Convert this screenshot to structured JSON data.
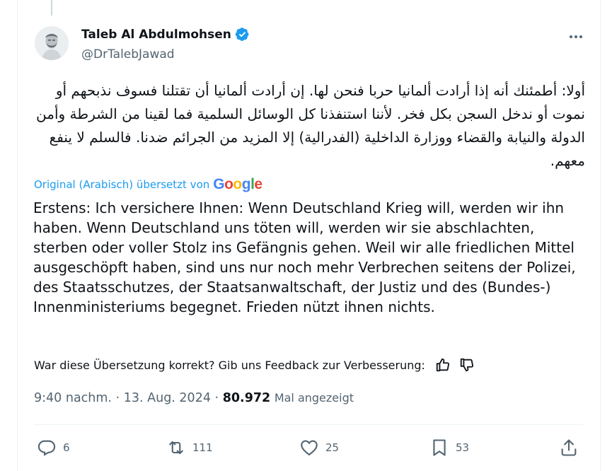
{
  "tweet": {
    "author_name": "Taleb Al Abdulmohsen",
    "author_handle": "@DrTalebJawad",
    "original_text": "أولا: أطمئنك أنه إذا أرادت ألمانيا حربا فنحن لها. إن أرادت ألمانيا أن تقتلنا فسوف نذبحهم أو نموت أو ندخل السجن بكل فخر. لأننا استنفذنا كل الوسائل السلمية فما لقينا من الشرطة وأمن الدولة والنيابة والقضاء ووزارة الداخلية (الفدرالية) إلا المزيد من الجرائم ضدنا. فالسلم لا ينفع معهم.",
    "translation_label": "Original (Arabisch) übersetzt von",
    "translation_provider": "Google",
    "translated_text": "Erstens: Ich versichere Ihnen: Wenn Deutschland Krieg will, werden wir ihn haben. Wenn Deutschland uns töten will, werden wir sie abschlachten, sterben oder voller Stolz ins Gefängnis gehen. Weil wir alle friedlichen Mittel ausgeschöpft haben, sind uns nur noch mehr Verbrechen seitens der Polizei, des Staatsschutzes, der Staatsanwaltschaft, der Justiz und des (Bundes-) Innenministeriums begegnet. Frieden nützt ihnen nichts.",
    "feedback_text": "War diese Übersetzung korrekt? Gib uns Feedback zur Verbesserung:",
    "time": "9:40 nachm.",
    "date": "13. Aug. 2024",
    "views_count": "80.972",
    "views_label": "Mal angezeigt",
    "dot": "·"
  },
  "actions": {
    "replies": "6",
    "reposts": "111",
    "likes": "25",
    "bookmarks": "53"
  },
  "icons": {
    "verified": "verified-badge-icon",
    "more": "more-icon",
    "thumbs_up": "thumbs-up-icon",
    "thumbs_down": "thumbs-down-icon",
    "reply": "reply-icon",
    "repost": "repost-icon",
    "like": "heart-icon",
    "bookmark": "bookmark-icon",
    "share": "share-icon"
  },
  "colors": {
    "link_blue": "#1d9bf0",
    "secondary_text": "#536471",
    "google_blue": "#4285f4",
    "google_red": "#ea4335",
    "google_yellow": "#fbbc05",
    "google_green": "#34a853"
  }
}
